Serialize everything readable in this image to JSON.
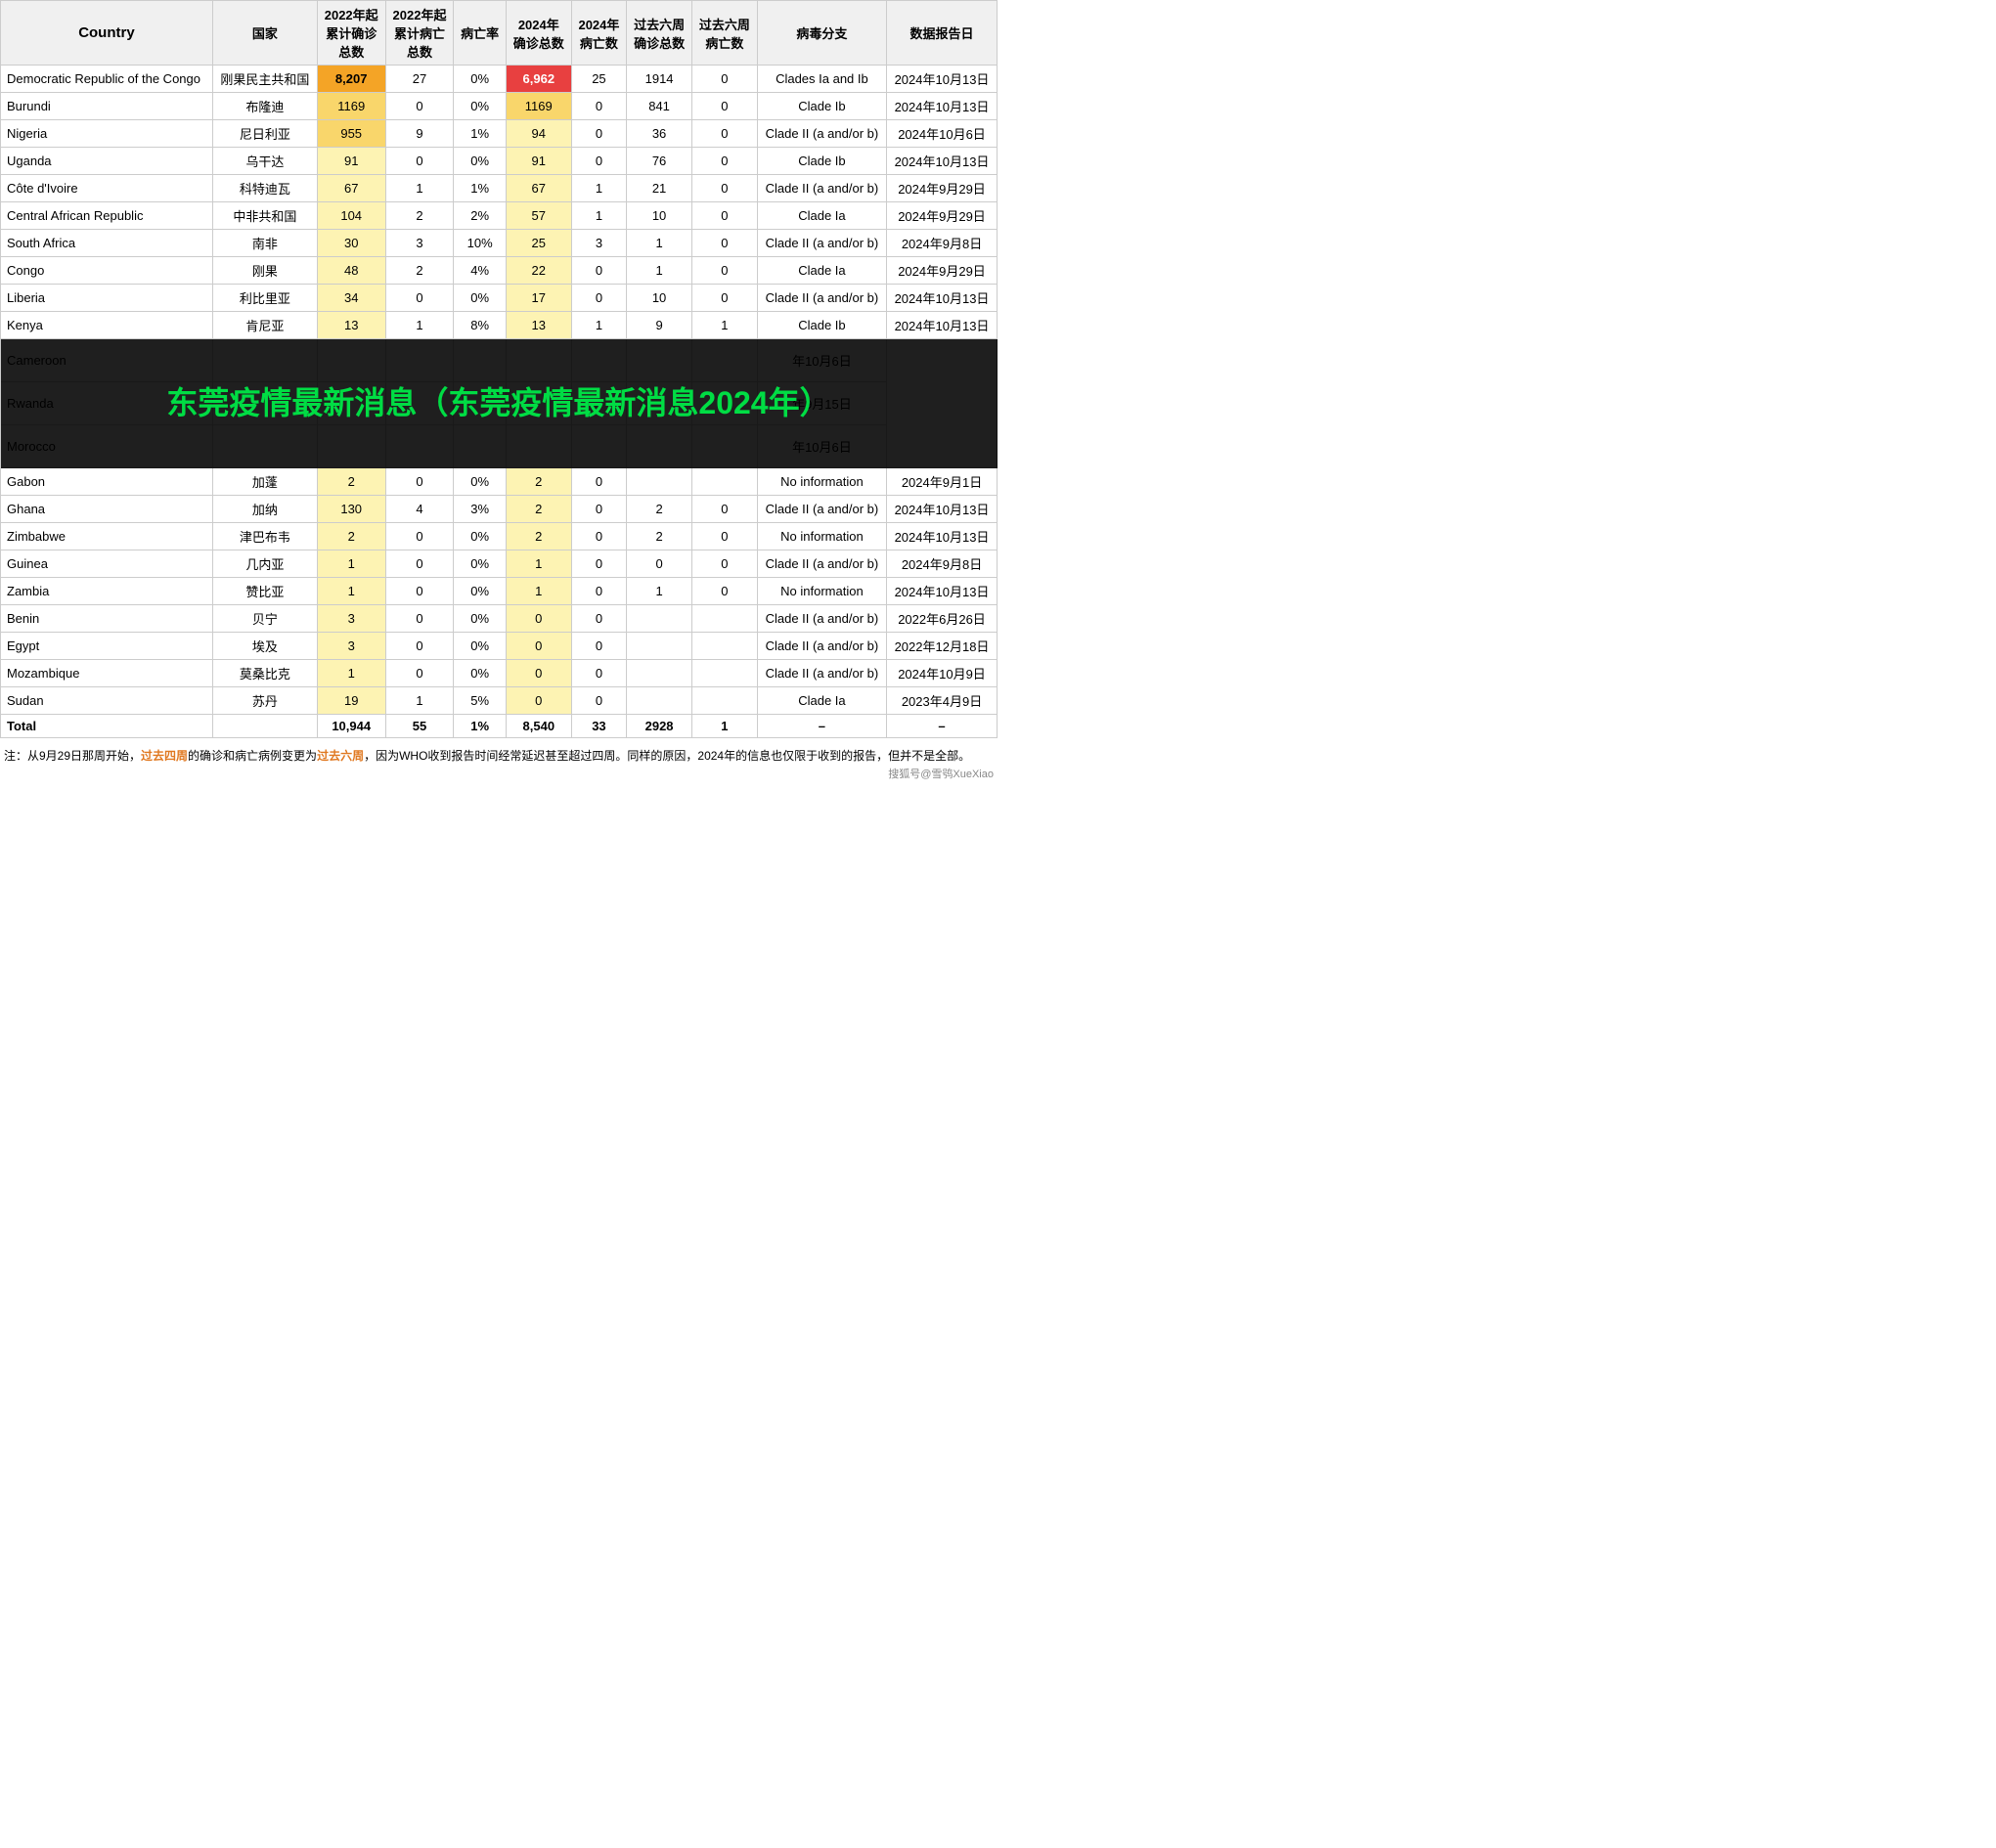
{
  "headers": {
    "country_en": "Country",
    "country_cn": "国家",
    "confirmed_2022": "2022年起\n累计确诊\n总数",
    "deaths_2022": "2022年起\n累计病亡\n总数",
    "death_rate": "病亡率",
    "confirmed_2024": "2024年\n确诊总数",
    "deaths_2024": "2024年\n病亡数",
    "confirmed_6w": "过去六周\n确诊总数",
    "deaths_6w": "过去六周\n病亡数",
    "clade": "病毒分支",
    "report_date": "数据报告日"
  },
  "rows": [
    {
      "country_en": "Democratic Republic of the Congo",
      "country_cn": "刚果民主共和国",
      "confirmed_2022": "8,207",
      "deaths_2022": "27",
      "death_rate": "0%",
      "confirmed_2024": "6,962",
      "deaths_2024": "25",
      "confirmed_6w": "1914",
      "deaths_6w": "0",
      "clade": "Clades Ia and Ib",
      "report_date": "2024年10月13日",
      "style_confirmed_2022": "bg-orange",
      "style_confirmed_2024": "bg-red"
    },
    {
      "country_en": "Burundi",
      "country_cn": "布隆迪",
      "confirmed_2022": "1169",
      "deaths_2022": "0",
      "death_rate": "0%",
      "confirmed_2024": "1169",
      "deaths_2024": "0",
      "confirmed_6w": "841",
      "deaths_6w": "0",
      "clade": "Clade Ib",
      "report_date": "2024年10月13日",
      "style_confirmed_2022": "bg-yellow",
      "style_confirmed_2024": "bg-yellow"
    },
    {
      "country_en": "Nigeria",
      "country_cn": "尼日利亚",
      "confirmed_2022": "955",
      "deaths_2022": "9",
      "death_rate": "1%",
      "confirmed_2024": "94",
      "deaths_2024": "0",
      "confirmed_6w": "36",
      "deaths_6w": "0",
      "clade": "Clade II (a and/or b)",
      "report_date": "2024年10月6日",
      "style_confirmed_2022": "bg-yellow",
      "style_confirmed_2024": "bg-lightyellow"
    },
    {
      "country_en": "Uganda",
      "country_cn": "乌干达",
      "confirmed_2022": "91",
      "deaths_2022": "0",
      "death_rate": "0%",
      "confirmed_2024": "91",
      "deaths_2024": "0",
      "confirmed_6w": "76",
      "deaths_6w": "0",
      "clade": "Clade Ib",
      "report_date": "2024年10月13日",
      "style_confirmed_2022": "bg-lightyellow",
      "style_confirmed_2024": "bg-lightyellow"
    },
    {
      "country_en": "Côte d'Ivoire",
      "country_cn": "科特迪瓦",
      "confirmed_2022": "67",
      "deaths_2022": "1",
      "death_rate": "1%",
      "confirmed_2024": "67",
      "deaths_2024": "1",
      "confirmed_6w": "21",
      "deaths_6w": "0",
      "clade": "Clade II (a and/or b)",
      "report_date": "2024年9月29日",
      "style_confirmed_2022": "bg-lightyellow",
      "style_confirmed_2024": "bg-lightyellow"
    },
    {
      "country_en": "Central African Republic",
      "country_cn": "中非共和国",
      "confirmed_2022": "104",
      "deaths_2022": "2",
      "death_rate": "2%",
      "confirmed_2024": "57",
      "deaths_2024": "1",
      "confirmed_6w": "10",
      "deaths_6w": "0",
      "clade": "Clade Ia",
      "report_date": "2024年9月29日",
      "style_confirmed_2022": "bg-lightyellow",
      "style_confirmed_2024": "bg-lightyellow"
    },
    {
      "country_en": "South Africa",
      "country_cn": "南非",
      "confirmed_2022": "30",
      "deaths_2022": "3",
      "death_rate": "10%",
      "confirmed_2024": "25",
      "deaths_2024": "3",
      "confirmed_6w": "1",
      "deaths_6w": "0",
      "clade": "Clade II (a and/or b)",
      "report_date": "2024年9月8日",
      "style_confirmed_2022": "bg-lightyellow",
      "style_confirmed_2024": "bg-lightyellow"
    },
    {
      "country_en": "Congo",
      "country_cn": "刚果",
      "confirmed_2022": "48",
      "deaths_2022": "2",
      "death_rate": "4%",
      "confirmed_2024": "22",
      "deaths_2024": "0",
      "confirmed_6w": "1",
      "deaths_6w": "0",
      "clade": "Clade Ia",
      "report_date": "2024年9月29日",
      "style_confirmed_2022": "bg-lightyellow",
      "style_confirmed_2024": "bg-lightyellow"
    },
    {
      "country_en": "Liberia",
      "country_cn": "利比里亚",
      "confirmed_2022": "34",
      "deaths_2022": "0",
      "death_rate": "0%",
      "confirmed_2024": "17",
      "deaths_2024": "0",
      "confirmed_6w": "10",
      "deaths_6w": "0",
      "clade": "Clade II (a and/or b)",
      "report_date": "2024年10月13日",
      "style_confirmed_2022": "bg-lightyellow",
      "style_confirmed_2024": "bg-lightyellow"
    },
    {
      "country_en": "Kenya",
      "country_cn": "肯尼亚",
      "confirmed_2022": "13",
      "deaths_2022": "1",
      "death_rate": "8%",
      "confirmed_2024": "13",
      "deaths_2024": "1",
      "confirmed_6w": "9",
      "deaths_6w": "1",
      "clade": "Clade Ib",
      "report_date": "2024年10月13日",
      "style_confirmed_2022": "bg-lightyellow",
      "style_confirmed_2024": "bg-lightyellow"
    },
    {
      "country_en": "Cameroon",
      "country_cn": "",
      "confirmed_2022": "",
      "deaths_2022": "",
      "death_rate": "",
      "confirmed_2024": "",
      "deaths_2024": "",
      "confirmed_6w": "",
      "deaths_6w": "",
      "clade": "",
      "report_date": "年10月6日",
      "overlay": true,
      "overlay_text": "东莞疫情最新消息（东莞疫情最新消息2024年）"
    },
    {
      "country_en": "Rwanda",
      "country_cn": "",
      "confirmed_2022": "",
      "deaths_2022": "",
      "death_rate": "",
      "confirmed_2024": "",
      "deaths_2024": "",
      "confirmed_6w": "",
      "deaths_6w": "",
      "clade": "",
      "report_date": "年9月15日",
      "overlay": true
    },
    {
      "country_en": "Morocco",
      "country_cn": "",
      "confirmed_2022": "",
      "deaths_2022": "",
      "death_rate": "",
      "confirmed_2024": "",
      "deaths_2024": "",
      "confirmed_6w": "",
      "deaths_6w": "",
      "clade": "",
      "report_date": "年10月6日",
      "overlay": true
    },
    {
      "country_en": "Gabon",
      "country_cn": "加蓬",
      "confirmed_2022": "2",
      "deaths_2022": "0",
      "death_rate": "0%",
      "confirmed_2024": "2",
      "deaths_2024": "0",
      "confirmed_6w": "",
      "deaths_6w": "",
      "clade": "No information",
      "report_date": "2024年9月1日",
      "style_confirmed_2022": "bg-lightyellow",
      "style_confirmed_2024": "bg-lightyellow"
    },
    {
      "country_en": "Ghana",
      "country_cn": "加纳",
      "confirmed_2022": "130",
      "deaths_2022": "4",
      "death_rate": "3%",
      "confirmed_2024": "2",
      "deaths_2024": "0",
      "confirmed_6w": "2",
      "deaths_6w": "0",
      "clade": "Clade II (a and/or b)",
      "report_date": "2024年10月13日",
      "style_confirmed_2022": "bg-lightyellow",
      "style_confirmed_2024": "bg-lightyellow"
    },
    {
      "country_en": "Zimbabwe",
      "country_cn": "津巴布韦",
      "confirmed_2022": "2",
      "deaths_2022": "0",
      "death_rate": "0%",
      "confirmed_2024": "2",
      "deaths_2024": "0",
      "confirmed_6w": "2",
      "deaths_6w": "0",
      "clade": "No information",
      "report_date": "2024年10月13日",
      "style_confirmed_2022": "bg-lightyellow",
      "style_confirmed_2024": "bg-lightyellow"
    },
    {
      "country_en": "Guinea",
      "country_cn": "几内亚",
      "confirmed_2022": "1",
      "deaths_2022": "0",
      "death_rate": "0%",
      "confirmed_2024": "1",
      "deaths_2024": "0",
      "confirmed_6w": "0",
      "deaths_6w": "0",
      "clade": "Clade II (a and/or b)",
      "report_date": "2024年9月8日",
      "style_confirmed_2022": "bg-lightyellow",
      "style_confirmed_2024": "bg-lightyellow"
    },
    {
      "country_en": "Zambia",
      "country_cn": "赞比亚",
      "confirmed_2022": "1",
      "deaths_2022": "0",
      "death_rate": "0%",
      "confirmed_2024": "1",
      "deaths_2024": "0",
      "confirmed_6w": "1",
      "deaths_6w": "0",
      "clade": "No information",
      "report_date": "2024年10月13日",
      "style_confirmed_2022": "bg-lightyellow",
      "style_confirmed_2024": "bg-lightyellow"
    },
    {
      "country_en": "Benin",
      "country_cn": "贝宁",
      "confirmed_2022": "3",
      "deaths_2022": "0",
      "death_rate": "0%",
      "confirmed_2024": "0",
      "deaths_2024": "0",
      "confirmed_6w": "",
      "deaths_6w": "",
      "clade": "Clade II (a and/or b)",
      "report_date": "2022年6月26日",
      "style_confirmed_2022": "bg-lightyellow",
      "style_confirmed_2024": "bg-lightyellow"
    },
    {
      "country_en": "Egypt",
      "country_cn": "埃及",
      "confirmed_2022": "3",
      "deaths_2022": "0",
      "death_rate": "0%",
      "confirmed_2024": "0",
      "deaths_2024": "0",
      "confirmed_6w": "",
      "deaths_6w": "",
      "clade": "Clade II (a and/or b)",
      "report_date": "2022年12月18日",
      "style_confirmed_2022": "bg-lightyellow",
      "style_confirmed_2024": "bg-lightyellow"
    },
    {
      "country_en": "Mozambique",
      "country_cn": "莫桑比克",
      "confirmed_2022": "1",
      "deaths_2022": "0",
      "death_rate": "0%",
      "confirmed_2024": "0",
      "deaths_2024": "0",
      "confirmed_6w": "",
      "deaths_6w": "",
      "clade": "Clade II (a and/or b)",
      "report_date": "2024年10月9日",
      "style_confirmed_2022": "bg-lightyellow",
      "style_confirmed_2024": "bg-lightyellow"
    },
    {
      "country_en": "Sudan",
      "country_cn": "苏丹",
      "confirmed_2022": "19",
      "deaths_2022": "1",
      "death_rate": "5%",
      "confirmed_2024": "0",
      "deaths_2024": "0",
      "confirmed_6w": "",
      "deaths_6w": "",
      "clade": "Clade Ia",
      "report_date": "2023年4月9日",
      "style_confirmed_2022": "bg-lightyellow",
      "style_confirmed_2024": "bg-lightyellow"
    }
  ],
  "total": {
    "label": "Total",
    "confirmed_2022": "10,944",
    "deaths_2022": "55",
    "death_rate": "1%",
    "confirmed_2024": "8,540",
    "deaths_2024": "33",
    "confirmed_6w": "2928",
    "deaths_6w": "1",
    "clade": "–",
    "report_date": "–"
  },
  "footnote": {
    "text1": "注：从9月29日那周开始，",
    "highlight1": "过去四周",
    "text2": "的确诊和病亡病例变更为",
    "highlight2": "过去六周",
    "text3": "，因为WHO收到报告时间经常延迟甚至超过四周。同样的原因，2024年的信息也仅限于收到的报告，但并不是全部。",
    "watermark": "搜狐号@雪鸮XueXiao"
  },
  "overlay": {
    "text": "东莞疫情最新消息（东莞疫情最新消息2024年）"
  }
}
